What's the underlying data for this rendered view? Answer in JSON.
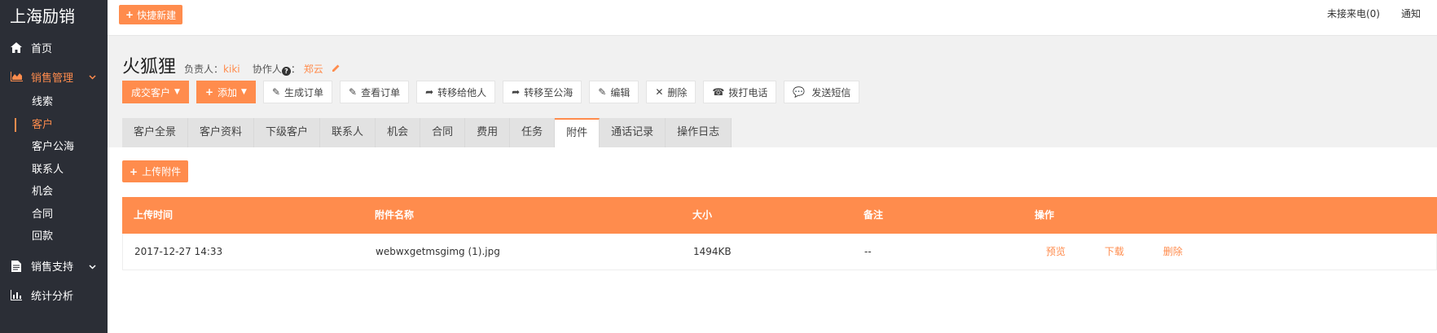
{
  "sidebar": {
    "brand": "上海励销",
    "items": [
      {
        "label": "首页",
        "icon": "home-icon"
      },
      {
        "label": "销售管理",
        "icon": "chart-icon"
      },
      {
        "label": "销售支持",
        "icon": "document-icon"
      },
      {
        "label": "统计分析",
        "icon": "bar-chart-icon"
      }
    ],
    "sub_items": [
      "线索",
      "客户",
      "客户公海",
      "联系人",
      "机会",
      "合同",
      "回款"
    ]
  },
  "topbar": {
    "quick_new": "快捷新建",
    "missed_calls": "未接来电(0)",
    "notifications": "通知"
  },
  "header": {
    "title": "火狐狸",
    "owner_label": "负责人：",
    "owner": "kiki",
    "collaborator_label": "协作人",
    "collaborator_sep": "：",
    "collaborator": "郑云"
  },
  "actions": {
    "deal": "成交客户",
    "add": "添加",
    "create_order": "生成订单",
    "view_order": "查看订单",
    "transfer_other": "转移给他人",
    "transfer_pool": "转移至公海",
    "edit": "编辑",
    "delete": "删除",
    "call": "拨打电话",
    "sms": "发送短信"
  },
  "tabs": [
    "客户全景",
    "客户资料",
    "下级客户",
    "联系人",
    "机会",
    "合同",
    "费用",
    "任务",
    "附件",
    "通话记录",
    "操作日志"
  ],
  "active_tab": "附件",
  "upload_label": "上传附件",
  "table": {
    "headers": [
      "上传时间",
      "附件名称",
      "大小",
      "备注",
      "操作"
    ],
    "rows": [
      {
        "time": "2017-12-27 14:33",
        "name": "webwxgetmsgimg (1).jpg",
        "size": "1494KB",
        "note": "--",
        "preview": "预览",
        "download": "下载",
        "delete": "删除"
      }
    ]
  },
  "colors": {
    "accent": "#ff8c4d",
    "sidebar": "#2b2e36"
  }
}
